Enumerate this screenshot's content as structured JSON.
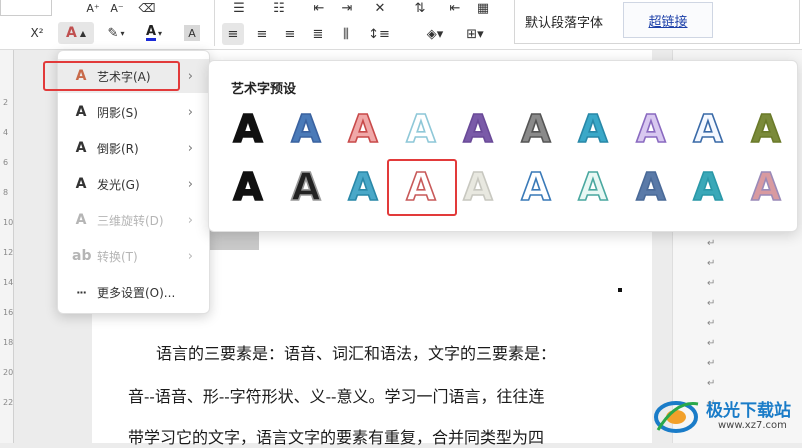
{
  "ribbon": {
    "font_size_up": "A⁺",
    "font_size_down": "A⁻",
    "superscript": "X²",
    "style_default": "默认段落字体",
    "style_link": "超链接"
  },
  "ruler": {
    "numbers": [
      "2",
      "4",
      "6",
      "8",
      "10",
      "12",
      "14",
      "16",
      "18",
      "20",
      "22"
    ]
  },
  "menu": {
    "items": [
      {
        "label": "艺术字(A)",
        "icon": "wordart-icon",
        "enabled": true
      },
      {
        "label": "阴影(S)",
        "icon": "shadow-icon",
        "enabled": true
      },
      {
        "label": "倒影(R)",
        "icon": "reflection-icon",
        "enabled": true
      },
      {
        "label": "发光(G)",
        "icon": "glow-icon",
        "enabled": true
      },
      {
        "label": "三维旋转(D)",
        "icon": "3d-rotate-icon",
        "enabled": false
      },
      {
        "label": "转换(T)",
        "icon": "transform-icon",
        "enabled": false
      },
      {
        "label": "更多设置(O)...",
        "icon": "more-icon",
        "enabled": true
      }
    ]
  },
  "gallery": {
    "title": "艺术字预设",
    "glyph": "A",
    "selected_index": 13,
    "presets": [
      {
        "fill": "#111111",
        "stroke": "#111111"
      },
      {
        "fill": "#4a7ab8",
        "stroke": "#3a62a0"
      },
      {
        "fill": "#f0a8a8",
        "stroke": "#c84a4a"
      },
      {
        "fill": "#ffffff",
        "stroke": "#8fc8d8"
      },
      {
        "fill": "#7a5aa8",
        "stroke": "#6a4a98"
      },
      {
        "fill": "#8a8a8a",
        "stroke": "#555555"
      },
      {
        "fill": "#3aa8c8",
        "stroke": "#2888a8"
      },
      {
        "fill": "#d8c8f0",
        "stroke": "#8a6ac0"
      },
      {
        "fill": "#f4f8ff",
        "stroke": "#3a6aa8"
      },
      {
        "fill": "#7a8a3a",
        "stroke": "#6a7a2a"
      },
      {
        "fill": "#111111",
        "stroke": "#111111"
      },
      {
        "fill": "#222222",
        "stroke": "#999999"
      },
      {
        "fill": "#4aa8c8",
        "stroke": "#2a88a8"
      },
      {
        "fill": "#ffffff",
        "stroke": "#c85a5a"
      },
      {
        "fill": "#e8e8e0",
        "stroke": "#c8c8c0"
      },
      {
        "fill": "#ffffff",
        "stroke": "#3a7ab8"
      },
      {
        "fill": "#e8f8f4",
        "stroke": "#4aa8a0"
      },
      {
        "fill": "#5a7aa8",
        "stroke": "#4a6a98"
      },
      {
        "fill": "#3aa8b8",
        "stroke": "#2a98a8"
      },
      {
        "fill": "#d89aa0",
        "stroke": "#9a8ab8"
      }
    ]
  },
  "document": {
    "lines": [
      "语言的三要素是：语音、词汇和语法，文字的三要素是：",
      "音--语音、形--字符形状、义--意义。学习一门语言，往往连",
      "带学习它的文字，语言文字的要素有重复，合并同类型为四"
    ]
  },
  "watermark": {
    "text": "极光下载站",
    "url": "www.xz7.com"
  },
  "colors": {
    "highlight": "#e23a3a",
    "link": "#1a3ea8"
  }
}
